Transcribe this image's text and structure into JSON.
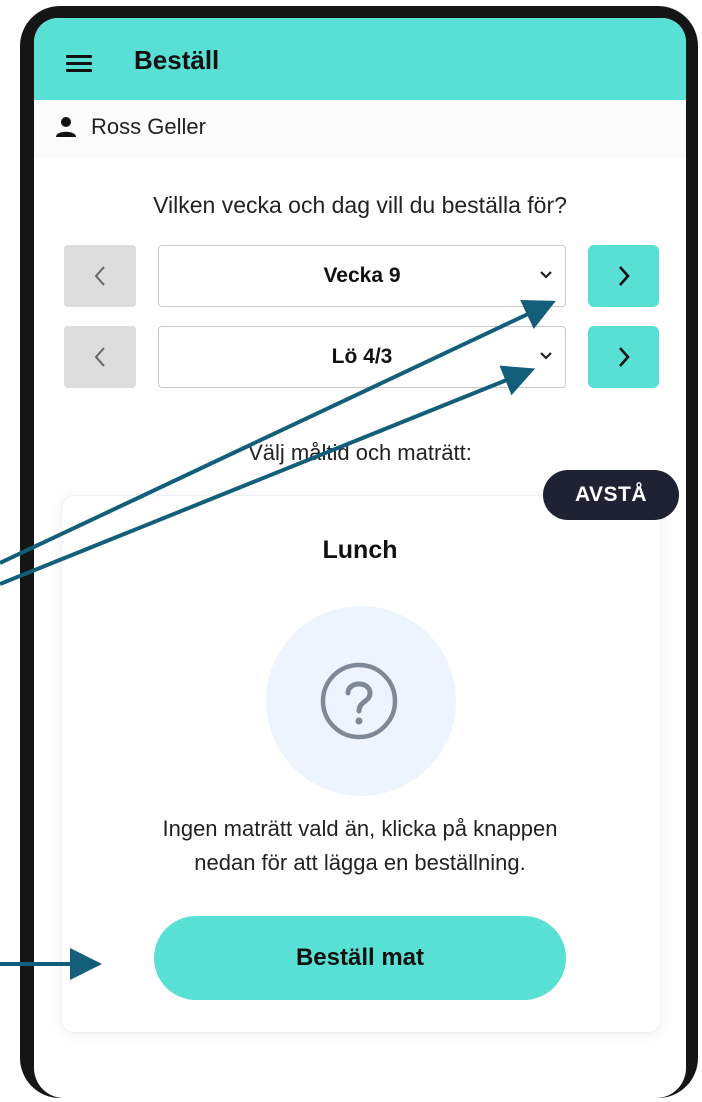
{
  "header": {
    "title": "Beställ",
    "menu_icon": "hamburger-menu-icon"
  },
  "user": {
    "name": "Ross Geller",
    "icon": "person-icon"
  },
  "question": "Vilken vecka och dag vill du beställa för?",
  "week_selector": {
    "value": "Vecka 9",
    "prev_icon": "chevron-left-icon",
    "next_icon": "chevron-right-icon"
  },
  "day_selector": {
    "value": "Lö 4/3",
    "prev_icon": "chevron-left-icon",
    "next_icon": "chevron-right-icon"
  },
  "meal_prompt": "Välj måltid och maträtt:",
  "meal_card": {
    "skip_badge": "AVSTÅ",
    "title": "Lunch",
    "placeholder_icon": "question-mark-icon",
    "empty_message_line1": "Ingen maträtt vald än, klicka på knappen",
    "empty_message_line2": "nedan för att lägga en beställning.",
    "order_button": "Beställ mat"
  },
  "colors": {
    "accent": "#58e0d5",
    "badge": "#1f2232",
    "annotation_arrow": "#135e78",
    "disabled": "#dddddd"
  }
}
